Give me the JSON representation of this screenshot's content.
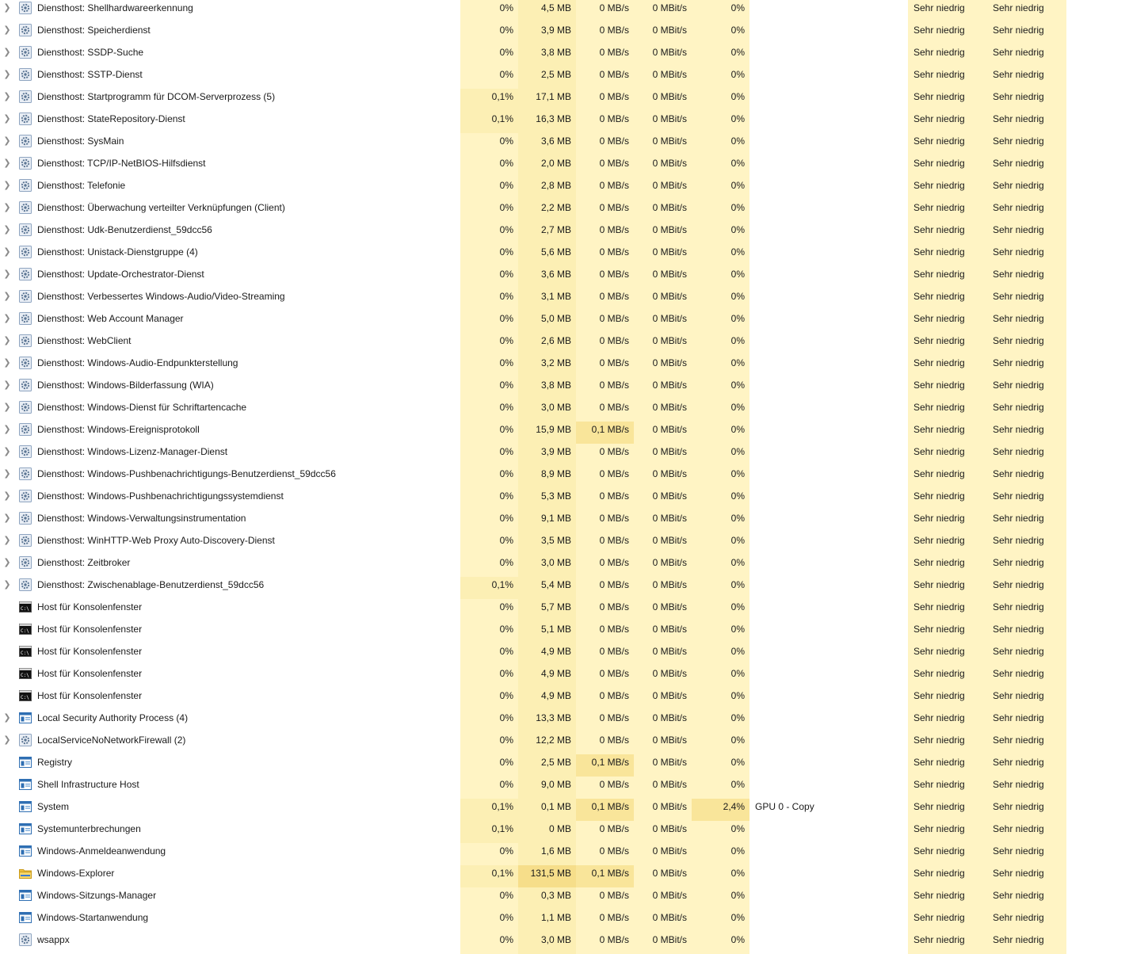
{
  "colors": {
    "heat_light": "#fff4c4",
    "heat_medium": "#fcefb4",
    "heat_strong": "#f9e59a",
    "heat_stronger": "#f6de8a",
    "text": "#1a1a1a"
  },
  "rows": [
    {
      "expandable": true,
      "icon": "gear-icon",
      "name": "Diensthost: Shellhardwareerkennung",
      "cpu": "0%",
      "mem": "4,5 MB",
      "disk": "0 MB/s",
      "net": "0 MBit/s",
      "gpu": "0%",
      "gpu_engine": "",
      "power": "Sehr niedrig",
      "power_trend": "Sehr niedrig",
      "heat": {
        "cpu": 0,
        "mem": 1,
        "disk": 0,
        "net": 0,
        "gpu": 0
      }
    },
    {
      "expandable": true,
      "icon": "gear-icon",
      "name": "Diensthost: Speicherdienst",
      "cpu": "0%",
      "mem": "3,9 MB",
      "disk": "0 MB/s",
      "net": "0 MBit/s",
      "gpu": "0%",
      "gpu_engine": "",
      "power": "Sehr niedrig",
      "power_trend": "Sehr niedrig",
      "heat": {
        "cpu": 0,
        "mem": 1,
        "disk": 0,
        "net": 0,
        "gpu": 0
      }
    },
    {
      "expandable": true,
      "icon": "gear-icon",
      "name": "Diensthost: SSDP-Suche",
      "cpu": "0%",
      "mem": "3,8 MB",
      "disk": "0 MB/s",
      "net": "0 MBit/s",
      "gpu": "0%",
      "gpu_engine": "",
      "power": "Sehr niedrig",
      "power_trend": "Sehr niedrig",
      "heat": {
        "cpu": 0,
        "mem": 1,
        "disk": 0,
        "net": 0,
        "gpu": 0
      }
    },
    {
      "expandable": true,
      "icon": "gear-icon",
      "name": "Diensthost: SSTP-Dienst",
      "cpu": "0%",
      "mem": "2,5 MB",
      "disk": "0 MB/s",
      "net": "0 MBit/s",
      "gpu": "0%",
      "gpu_engine": "",
      "power": "Sehr niedrig",
      "power_trend": "Sehr niedrig",
      "heat": {
        "cpu": 0,
        "mem": 1,
        "disk": 0,
        "net": 0,
        "gpu": 0
      }
    },
    {
      "expandable": true,
      "icon": "gear-icon",
      "name": "Diensthost: Startprogramm für DCOM-Serverprozess (5)",
      "cpu": "0,1%",
      "mem": "17,1 MB",
      "disk": "0 MB/s",
      "net": "0 MBit/s",
      "gpu": "0%",
      "gpu_engine": "",
      "power": "Sehr niedrig",
      "power_trend": "Sehr niedrig",
      "heat": {
        "cpu": 1,
        "mem": 1,
        "disk": 0,
        "net": 0,
        "gpu": 0
      }
    },
    {
      "expandable": true,
      "icon": "gear-icon",
      "name": "Diensthost: StateRepository-Dienst",
      "cpu": "0,1%",
      "mem": "16,3 MB",
      "disk": "0 MB/s",
      "net": "0 MBit/s",
      "gpu": "0%",
      "gpu_engine": "",
      "power": "Sehr niedrig",
      "power_trend": "Sehr niedrig",
      "heat": {
        "cpu": 1,
        "mem": 1,
        "disk": 0,
        "net": 0,
        "gpu": 0
      }
    },
    {
      "expandable": true,
      "icon": "gear-icon",
      "name": "Diensthost: SysMain",
      "cpu": "0%",
      "mem": "3,6 MB",
      "disk": "0 MB/s",
      "net": "0 MBit/s",
      "gpu": "0%",
      "gpu_engine": "",
      "power": "Sehr niedrig",
      "power_trend": "Sehr niedrig",
      "heat": {
        "cpu": 0,
        "mem": 1,
        "disk": 0,
        "net": 0,
        "gpu": 0
      }
    },
    {
      "expandable": true,
      "icon": "gear-icon",
      "name": "Diensthost: TCP/IP-NetBIOS-Hilfsdienst",
      "cpu": "0%",
      "mem": "2,0 MB",
      "disk": "0 MB/s",
      "net": "0 MBit/s",
      "gpu": "0%",
      "gpu_engine": "",
      "power": "Sehr niedrig",
      "power_trend": "Sehr niedrig",
      "heat": {
        "cpu": 0,
        "mem": 1,
        "disk": 0,
        "net": 0,
        "gpu": 0
      }
    },
    {
      "expandable": true,
      "icon": "gear-icon",
      "name": "Diensthost: Telefonie",
      "cpu": "0%",
      "mem": "2,8 MB",
      "disk": "0 MB/s",
      "net": "0 MBit/s",
      "gpu": "0%",
      "gpu_engine": "",
      "power": "Sehr niedrig",
      "power_trend": "Sehr niedrig",
      "heat": {
        "cpu": 0,
        "mem": 1,
        "disk": 0,
        "net": 0,
        "gpu": 0
      }
    },
    {
      "expandable": true,
      "icon": "gear-icon",
      "name": "Diensthost: Überwachung verteilter Verknüpfungen (Client)",
      "cpu": "0%",
      "mem": "2,2 MB",
      "disk": "0 MB/s",
      "net": "0 MBit/s",
      "gpu": "0%",
      "gpu_engine": "",
      "power": "Sehr niedrig",
      "power_trend": "Sehr niedrig",
      "heat": {
        "cpu": 0,
        "mem": 1,
        "disk": 0,
        "net": 0,
        "gpu": 0
      }
    },
    {
      "expandable": true,
      "icon": "gear-icon",
      "name": "Diensthost: Udk-Benutzerdienst_59dcc56",
      "cpu": "0%",
      "mem": "2,7 MB",
      "disk": "0 MB/s",
      "net": "0 MBit/s",
      "gpu": "0%",
      "gpu_engine": "",
      "power": "Sehr niedrig",
      "power_trend": "Sehr niedrig",
      "heat": {
        "cpu": 0,
        "mem": 1,
        "disk": 0,
        "net": 0,
        "gpu": 0
      }
    },
    {
      "expandable": true,
      "icon": "gear-icon",
      "name": "Diensthost: Unistack-Dienstgruppe (4)",
      "cpu": "0%",
      "mem": "5,6 MB",
      "disk": "0 MB/s",
      "net": "0 MBit/s",
      "gpu": "0%",
      "gpu_engine": "",
      "power": "Sehr niedrig",
      "power_trend": "Sehr niedrig",
      "heat": {
        "cpu": 0,
        "mem": 1,
        "disk": 0,
        "net": 0,
        "gpu": 0
      }
    },
    {
      "expandable": true,
      "icon": "gear-icon",
      "name": "Diensthost: Update-Orchestrator-Dienst",
      "cpu": "0%",
      "mem": "3,6 MB",
      "disk": "0 MB/s",
      "net": "0 MBit/s",
      "gpu": "0%",
      "gpu_engine": "",
      "power": "Sehr niedrig",
      "power_trend": "Sehr niedrig",
      "heat": {
        "cpu": 0,
        "mem": 1,
        "disk": 0,
        "net": 0,
        "gpu": 0
      }
    },
    {
      "expandable": true,
      "icon": "gear-icon",
      "name": "Diensthost: Verbessertes Windows-Audio/Video-Streaming",
      "cpu": "0%",
      "mem": "3,1 MB",
      "disk": "0 MB/s",
      "net": "0 MBit/s",
      "gpu": "0%",
      "gpu_engine": "",
      "power": "Sehr niedrig",
      "power_trend": "Sehr niedrig",
      "heat": {
        "cpu": 0,
        "mem": 1,
        "disk": 0,
        "net": 0,
        "gpu": 0
      }
    },
    {
      "expandable": true,
      "icon": "gear-icon",
      "name": "Diensthost: Web Account Manager",
      "cpu": "0%",
      "mem": "5,0 MB",
      "disk": "0 MB/s",
      "net": "0 MBit/s",
      "gpu": "0%",
      "gpu_engine": "",
      "power": "Sehr niedrig",
      "power_trend": "Sehr niedrig",
      "heat": {
        "cpu": 0,
        "mem": 1,
        "disk": 0,
        "net": 0,
        "gpu": 0
      }
    },
    {
      "expandable": true,
      "icon": "gear-icon",
      "name": "Diensthost: WebClient",
      "cpu": "0%",
      "mem": "2,6 MB",
      "disk": "0 MB/s",
      "net": "0 MBit/s",
      "gpu": "0%",
      "gpu_engine": "",
      "power": "Sehr niedrig",
      "power_trend": "Sehr niedrig",
      "heat": {
        "cpu": 0,
        "mem": 1,
        "disk": 0,
        "net": 0,
        "gpu": 0
      }
    },
    {
      "expandable": true,
      "icon": "gear-icon",
      "name": "Diensthost: Windows-Audio-Endpunkterstellung",
      "cpu": "0%",
      "mem": "3,2 MB",
      "disk": "0 MB/s",
      "net": "0 MBit/s",
      "gpu": "0%",
      "gpu_engine": "",
      "power": "Sehr niedrig",
      "power_trend": "Sehr niedrig",
      "heat": {
        "cpu": 0,
        "mem": 1,
        "disk": 0,
        "net": 0,
        "gpu": 0
      }
    },
    {
      "expandable": true,
      "icon": "gear-icon",
      "name": "Diensthost: Windows-Bilderfassung (WIA)",
      "cpu": "0%",
      "mem": "3,8 MB",
      "disk": "0 MB/s",
      "net": "0 MBit/s",
      "gpu": "0%",
      "gpu_engine": "",
      "power": "Sehr niedrig",
      "power_trend": "Sehr niedrig",
      "heat": {
        "cpu": 0,
        "mem": 1,
        "disk": 0,
        "net": 0,
        "gpu": 0
      }
    },
    {
      "expandable": true,
      "icon": "gear-icon",
      "name": "Diensthost: Windows-Dienst für Schriftartencache",
      "cpu": "0%",
      "mem": "3,0 MB",
      "disk": "0 MB/s",
      "net": "0 MBit/s",
      "gpu": "0%",
      "gpu_engine": "",
      "power": "Sehr niedrig",
      "power_trend": "Sehr niedrig",
      "heat": {
        "cpu": 0,
        "mem": 1,
        "disk": 0,
        "net": 0,
        "gpu": 0
      }
    },
    {
      "expandable": true,
      "icon": "gear-icon",
      "name": "Diensthost: Windows-Ereignisprotokoll",
      "cpu": "0%",
      "mem": "15,9 MB",
      "disk": "0,1 MB/s",
      "net": "0 MBit/s",
      "gpu": "0%",
      "gpu_engine": "",
      "power": "Sehr niedrig",
      "power_trend": "Sehr niedrig",
      "heat": {
        "cpu": 0,
        "mem": 1,
        "disk": 2,
        "net": 0,
        "gpu": 0
      }
    },
    {
      "expandable": true,
      "icon": "gear-icon",
      "name": "Diensthost: Windows-Lizenz-Manager-Dienst",
      "cpu": "0%",
      "mem": "3,9 MB",
      "disk": "0 MB/s",
      "net": "0 MBit/s",
      "gpu": "0%",
      "gpu_engine": "",
      "power": "Sehr niedrig",
      "power_trend": "Sehr niedrig",
      "heat": {
        "cpu": 0,
        "mem": 1,
        "disk": 0,
        "net": 0,
        "gpu": 0
      }
    },
    {
      "expandable": true,
      "icon": "gear-icon",
      "name": "Diensthost: Windows-Pushbenachrichtigungs-Benutzerdienst_59dcc56",
      "cpu": "0%",
      "mem": "8,9 MB",
      "disk": "0 MB/s",
      "net": "0 MBit/s",
      "gpu": "0%",
      "gpu_engine": "",
      "power": "Sehr niedrig",
      "power_trend": "Sehr niedrig",
      "heat": {
        "cpu": 0,
        "mem": 1,
        "disk": 0,
        "net": 0,
        "gpu": 0
      }
    },
    {
      "expandable": true,
      "icon": "gear-icon",
      "name": "Diensthost: Windows-Pushbenachrichtigungssystemdienst",
      "cpu": "0%",
      "mem": "5,3 MB",
      "disk": "0 MB/s",
      "net": "0 MBit/s",
      "gpu": "0%",
      "gpu_engine": "",
      "power": "Sehr niedrig",
      "power_trend": "Sehr niedrig",
      "heat": {
        "cpu": 0,
        "mem": 1,
        "disk": 0,
        "net": 0,
        "gpu": 0
      }
    },
    {
      "expandable": true,
      "icon": "gear-icon",
      "name": "Diensthost: Windows-Verwaltungsinstrumentation",
      "cpu": "0%",
      "mem": "9,1 MB",
      "disk": "0 MB/s",
      "net": "0 MBit/s",
      "gpu": "0%",
      "gpu_engine": "",
      "power": "Sehr niedrig",
      "power_trend": "Sehr niedrig",
      "heat": {
        "cpu": 0,
        "mem": 1,
        "disk": 0,
        "net": 0,
        "gpu": 0
      }
    },
    {
      "expandable": true,
      "icon": "gear-icon",
      "name": "Diensthost: WinHTTP-Web Proxy Auto-Discovery-Dienst",
      "cpu": "0%",
      "mem": "3,5 MB",
      "disk": "0 MB/s",
      "net": "0 MBit/s",
      "gpu": "0%",
      "gpu_engine": "",
      "power": "Sehr niedrig",
      "power_trend": "Sehr niedrig",
      "heat": {
        "cpu": 0,
        "mem": 1,
        "disk": 0,
        "net": 0,
        "gpu": 0
      }
    },
    {
      "expandable": true,
      "icon": "gear-icon",
      "name": "Diensthost: Zeitbroker",
      "cpu": "0%",
      "mem": "3,0 MB",
      "disk": "0 MB/s",
      "net": "0 MBit/s",
      "gpu": "0%",
      "gpu_engine": "",
      "power": "Sehr niedrig",
      "power_trend": "Sehr niedrig",
      "heat": {
        "cpu": 0,
        "mem": 1,
        "disk": 0,
        "net": 0,
        "gpu": 0
      }
    },
    {
      "expandable": true,
      "icon": "gear-icon",
      "name": "Diensthost: Zwischenablage-Benutzerdienst_59dcc56",
      "cpu": "0,1%",
      "mem": "5,4 MB",
      "disk": "0 MB/s",
      "net": "0 MBit/s",
      "gpu": "0%",
      "gpu_engine": "",
      "power": "Sehr niedrig",
      "power_trend": "Sehr niedrig",
      "heat": {
        "cpu": 1,
        "mem": 1,
        "disk": 0,
        "net": 0,
        "gpu": 0
      }
    },
    {
      "expandable": false,
      "icon": "console-icon",
      "name": "Host für Konsolenfenster",
      "cpu": "0%",
      "mem": "5,7 MB",
      "disk": "0 MB/s",
      "net": "0 MBit/s",
      "gpu": "0%",
      "gpu_engine": "",
      "power": "Sehr niedrig",
      "power_trend": "Sehr niedrig",
      "heat": {
        "cpu": 0,
        "mem": 1,
        "disk": 0,
        "net": 0,
        "gpu": 0
      }
    },
    {
      "expandable": false,
      "icon": "console-icon",
      "name": "Host für Konsolenfenster",
      "cpu": "0%",
      "mem": "5,1 MB",
      "disk": "0 MB/s",
      "net": "0 MBit/s",
      "gpu": "0%",
      "gpu_engine": "",
      "power": "Sehr niedrig",
      "power_trend": "Sehr niedrig",
      "heat": {
        "cpu": 0,
        "mem": 1,
        "disk": 0,
        "net": 0,
        "gpu": 0
      }
    },
    {
      "expandable": false,
      "icon": "console-icon",
      "name": "Host für Konsolenfenster",
      "cpu": "0%",
      "mem": "4,9 MB",
      "disk": "0 MB/s",
      "net": "0 MBit/s",
      "gpu": "0%",
      "gpu_engine": "",
      "power": "Sehr niedrig",
      "power_trend": "Sehr niedrig",
      "heat": {
        "cpu": 0,
        "mem": 1,
        "disk": 0,
        "net": 0,
        "gpu": 0
      }
    },
    {
      "expandable": false,
      "icon": "console-icon",
      "name": "Host für Konsolenfenster",
      "cpu": "0%",
      "mem": "4,9 MB",
      "disk": "0 MB/s",
      "net": "0 MBit/s",
      "gpu": "0%",
      "gpu_engine": "",
      "power": "Sehr niedrig",
      "power_trend": "Sehr niedrig",
      "heat": {
        "cpu": 0,
        "mem": 1,
        "disk": 0,
        "net": 0,
        "gpu": 0
      }
    },
    {
      "expandable": false,
      "icon": "console-icon",
      "name": "Host für Konsolenfenster",
      "cpu": "0%",
      "mem": "4,9 MB",
      "disk": "0 MB/s",
      "net": "0 MBit/s",
      "gpu": "0%",
      "gpu_engine": "",
      "power": "Sehr niedrig",
      "power_trend": "Sehr niedrig",
      "heat": {
        "cpu": 0,
        "mem": 1,
        "disk": 0,
        "net": 0,
        "gpu": 0
      }
    },
    {
      "expandable": true,
      "icon": "app-window-icon",
      "name": "Local Security Authority Process (4)",
      "cpu": "0%",
      "mem": "13,3 MB",
      "disk": "0 MB/s",
      "net": "0 MBit/s",
      "gpu": "0%",
      "gpu_engine": "",
      "power": "Sehr niedrig",
      "power_trend": "Sehr niedrig",
      "heat": {
        "cpu": 0,
        "mem": 1,
        "disk": 0,
        "net": 0,
        "gpu": 0
      }
    },
    {
      "expandable": true,
      "icon": "gear-icon",
      "name": "LocalServiceNoNetworkFirewall (2)",
      "cpu": "0%",
      "mem": "12,2 MB",
      "disk": "0 MB/s",
      "net": "0 MBit/s",
      "gpu": "0%",
      "gpu_engine": "",
      "power": "Sehr niedrig",
      "power_trend": "Sehr niedrig",
      "heat": {
        "cpu": 0,
        "mem": 1,
        "disk": 0,
        "net": 0,
        "gpu": 0
      }
    },
    {
      "expandable": false,
      "icon": "app-window-icon",
      "name": "Registry",
      "cpu": "0%",
      "mem": "2,5 MB",
      "disk": "0,1 MB/s",
      "net": "0 MBit/s",
      "gpu": "0%",
      "gpu_engine": "",
      "power": "Sehr niedrig",
      "power_trend": "Sehr niedrig",
      "heat": {
        "cpu": 0,
        "mem": 1,
        "disk": 2,
        "net": 0,
        "gpu": 0
      }
    },
    {
      "expandable": false,
      "icon": "app-window-icon",
      "name": "Shell Infrastructure Host",
      "cpu": "0%",
      "mem": "9,0 MB",
      "disk": "0 MB/s",
      "net": "0 MBit/s",
      "gpu": "0%",
      "gpu_engine": "",
      "power": "Sehr niedrig",
      "power_trend": "Sehr niedrig",
      "heat": {
        "cpu": 0,
        "mem": 1,
        "disk": 0,
        "net": 0,
        "gpu": 0
      }
    },
    {
      "expandable": false,
      "icon": "app-window-icon",
      "name": "System",
      "cpu": "0,1%",
      "mem": "0,1 MB",
      "disk": "0,1 MB/s",
      "net": "0 MBit/s",
      "gpu": "2,4%",
      "gpu_engine": "GPU 0 - Copy",
      "power": "Sehr niedrig",
      "power_trend": "Sehr niedrig",
      "heat": {
        "cpu": 1,
        "mem": 1,
        "disk": 2,
        "net": 0,
        "gpu": 2
      }
    },
    {
      "expandable": false,
      "icon": "app-window-icon",
      "name": "Systemunterbrechungen",
      "cpu": "0,1%",
      "mem": "0 MB",
      "disk": "0 MB/s",
      "net": "0 MBit/s",
      "gpu": "0%",
      "gpu_engine": "",
      "power": "Sehr niedrig",
      "power_trend": "Sehr niedrig",
      "heat": {
        "cpu": 1,
        "mem": 1,
        "disk": 0,
        "net": 0,
        "gpu": 0
      }
    },
    {
      "expandable": false,
      "icon": "app-window-icon",
      "name": "Windows-Anmeldeanwendung",
      "cpu": "0%",
      "mem": "1,6 MB",
      "disk": "0 MB/s",
      "net": "0 MBit/s",
      "gpu": "0%",
      "gpu_engine": "",
      "power": "Sehr niedrig",
      "power_trend": "Sehr niedrig",
      "heat": {
        "cpu": 0,
        "mem": 1,
        "disk": 0,
        "net": 0,
        "gpu": 0
      }
    },
    {
      "expandable": false,
      "icon": "folder-icon",
      "name": "Windows-Explorer",
      "cpu": "0,1%",
      "mem": "131,5 MB",
      "disk": "0,1 MB/s",
      "net": "0 MBit/s",
      "gpu": "0%",
      "gpu_engine": "",
      "power": "Sehr niedrig",
      "power_trend": "Sehr niedrig",
      "heat": {
        "cpu": 1,
        "mem": 3,
        "disk": 2,
        "net": 0,
        "gpu": 0
      }
    },
    {
      "expandable": false,
      "icon": "app-window-icon",
      "name": "Windows-Sitzungs-Manager",
      "cpu": "0%",
      "mem": "0,3 MB",
      "disk": "0 MB/s",
      "net": "0 MBit/s",
      "gpu": "0%",
      "gpu_engine": "",
      "power": "Sehr niedrig",
      "power_trend": "Sehr niedrig",
      "heat": {
        "cpu": 0,
        "mem": 1,
        "disk": 0,
        "net": 0,
        "gpu": 0
      }
    },
    {
      "expandable": false,
      "icon": "app-window-icon",
      "name": "Windows-Startanwendung",
      "cpu": "0%",
      "mem": "1,1 MB",
      "disk": "0 MB/s",
      "net": "0 MBit/s",
      "gpu": "0%",
      "gpu_engine": "",
      "power": "Sehr niedrig",
      "power_trend": "Sehr niedrig",
      "heat": {
        "cpu": 0,
        "mem": 1,
        "disk": 0,
        "net": 0,
        "gpu": 0
      }
    },
    {
      "expandable": false,
      "icon": "gear-icon",
      "name": "wsappx",
      "cpu": "0%",
      "mem": "3,0 MB",
      "disk": "0 MB/s",
      "net": "0 MBit/s",
      "gpu": "0%",
      "gpu_engine": "",
      "power": "Sehr niedrig",
      "power_trend": "Sehr niedrig",
      "heat": {
        "cpu": 0,
        "mem": 1,
        "disk": 0,
        "net": 0,
        "gpu": 0
      }
    }
  ]
}
